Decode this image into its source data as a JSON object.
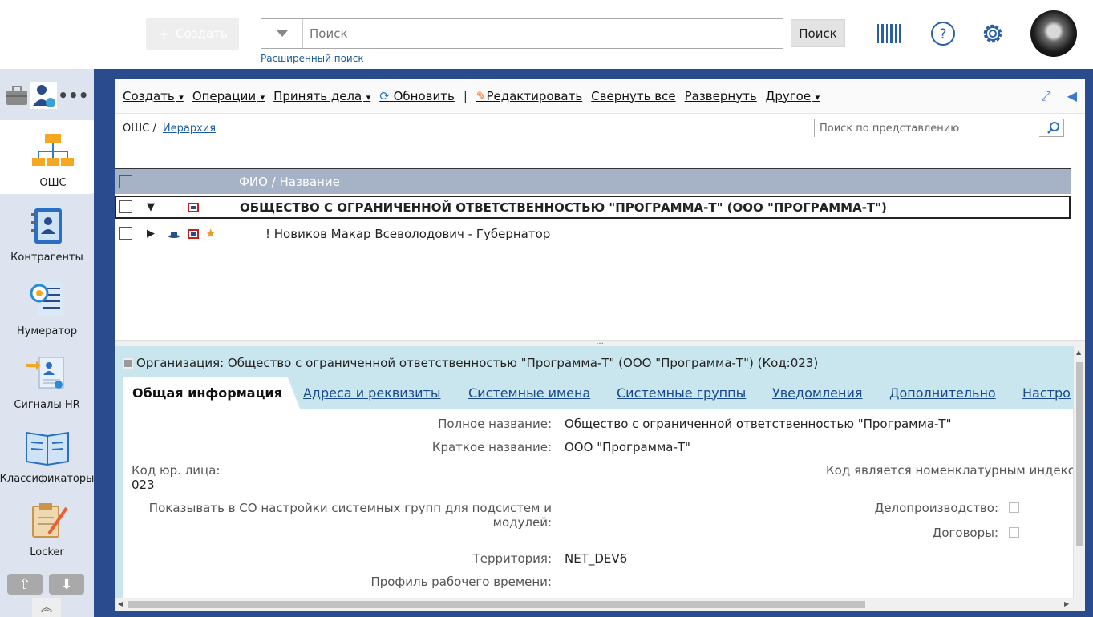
{
  "topbar": {
    "create_label": "Создать",
    "search_placeholder": "Поиск",
    "search_button": "Поиск",
    "advanced_search": "Расширенный поиск"
  },
  "leftnav": {
    "items": [
      {
        "label": "ОШС"
      },
      {
        "label": "Контрагенты"
      },
      {
        "label": "Нумератор"
      },
      {
        "label": "Сигналы HR"
      },
      {
        "label": "Классификаторы"
      },
      {
        "label": "Locker"
      }
    ]
  },
  "toolbar": {
    "create": "Создать",
    "operations": "Операции",
    "accept_cases": "Принять дела",
    "refresh": "Обновить",
    "separator": "|",
    "edit": "Редактировать",
    "collapse_all": "Свернуть все",
    "expand": "Развернуть",
    "other": "Другое"
  },
  "breadcrumb": {
    "root": "ОШС",
    "sep": "/",
    "current": "Иерархия"
  },
  "view_search_placeholder": "Поиск по представлению",
  "grid": {
    "column": "ФИО / Название",
    "rows": [
      {
        "text": "ОБЩЕСТВО С ОГРАНИЧЕННОЙ ОТВЕТСТВЕННОСТЬЮ \"ПРОГРАММА-Т\" (ООО \"ПРОГРАММА-Т\")",
        "expanded": true
      },
      {
        "text": "! Новиков Макар Всеволодович - Губернатор",
        "expanded": false
      }
    ]
  },
  "detail": {
    "title": "Организация: Общество с ограниченной ответственностью \"Программа-Т\" (ООО \"Программа-Т\") (Код:023)",
    "tabs": [
      "Общая информация",
      "Адреса и реквизиты",
      "Системные имена",
      "Системные группы",
      "Уведомления",
      "Дополнительно",
      "Настро"
    ],
    "fields": {
      "full_name_label": "Полное название:",
      "full_name": "Общество с ограниченной ответственностью \"Программа-Т\"",
      "short_name_label": "Краткое название:",
      "short_name": "ООО \"Программа-Т\"",
      "legal_code_label": "Код юр. лица:",
      "legal_code": "023",
      "code_index_label": "Код является номенклатурным индексом",
      "show_groups_label_1": "Показывать в СО настройки системных групп для подсистем и",
      "show_groups_label_2": "модулей:",
      "records_label": "Делопроизводство:",
      "contracts_label": "Договоры:",
      "territory_label": "Территория:",
      "territory": "NET_DEV6",
      "work_profile_label": "Профиль рабочего времени:"
    }
  },
  "colors": {
    "accent_blue": "#2b4b8f",
    "detail_bg": "#c9e6ee",
    "grid_header": "#a6b2c6",
    "nav_bg": "#dde4ef"
  }
}
